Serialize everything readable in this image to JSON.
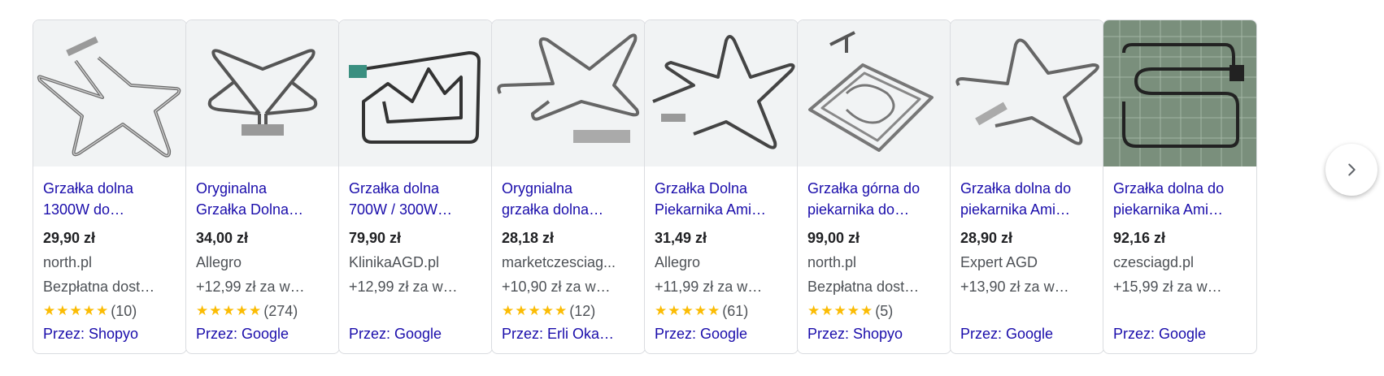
{
  "products": [
    {
      "title_line1": "Grzałka dolna",
      "title_line2": "1300W do…",
      "price": "29,90 zł",
      "store": "north.pl",
      "shipping": "Bezpłatna dost…",
      "stars": "★★★★★",
      "rating_count": "(10)",
      "via": "Przez: Shopyo",
      "image": "heating-element-star-icon"
    },
    {
      "title_line1": "Oryginalna",
      "title_line2": "Grzałka Dolna…",
      "price": "34,00 zł",
      "store": "Allegro",
      "shipping": "+12,99 zł za w…",
      "stars": "★★★★★",
      "rating_count": "(274)",
      "via": "Przez: Google",
      "image": "heating-element-butterfly-icon"
    },
    {
      "title_line1": "Grzałka dolna",
      "title_line2": "700W / 300W…",
      "price": "79,90 zł",
      "store": "KlinikaAGD.pl",
      "shipping": "+12,99 zł za w…",
      "stars": "",
      "rating_count": "",
      "via": "Przez: Google",
      "image": "heating-element-square-icon"
    },
    {
      "title_line1": "Orygnialna",
      "title_line2": "grzałka dolna…",
      "price": "28,18 zł",
      "store": "marketczesciag...",
      "shipping": "+10,90 zł za w…",
      "stars": "★★★★★",
      "rating_count": "(12)",
      "via": "Przez: Erli Oka…",
      "image": "heating-element-star-icon"
    },
    {
      "title_line1": "Grzałka Dolna",
      "title_line2": "Piekarnika Ami…",
      "price": "31,49 zł",
      "store": "Allegro",
      "shipping": "+11,99 zł za w…",
      "stars": "★★★★★",
      "rating_count": "(61)",
      "via": "Przez: Google",
      "image": "heating-element-star-icon"
    },
    {
      "title_line1": "Grzałka górna do",
      "title_line2": "piekarnika do…",
      "price": "99,00 zł",
      "store": "north.pl",
      "shipping": "Bezpłatna dost…",
      "stars": "★★★★★",
      "rating_count": "(5)",
      "via": "Przez: Shopyo",
      "image": "heating-element-double-loop-icon"
    },
    {
      "title_line1": "Grzałka dolna do",
      "title_line2": "piekarnika Ami…",
      "price": "28,90 zł",
      "store": "Expert AGD",
      "shipping": "+13,90 zł za w…",
      "stars": "",
      "rating_count": "",
      "via": "Przez: Google",
      "image": "heating-element-star-icon"
    },
    {
      "title_line1": "Grzałka dolna do",
      "title_line2": "piekarnika Ami…",
      "price": "92,16 zł",
      "store": "czesciagd.pl",
      "shipping": "+15,99 zł za w…",
      "stars": "",
      "rating_count": "",
      "via": "Przez: Google",
      "image": "heating-element-on-grid-icon"
    }
  ],
  "next_button": {
    "icon": "chevron-right-icon"
  },
  "colors": {
    "link": "#1a0dab",
    "star": "#fbbc04",
    "border": "#dadce0",
    "text": "#202124",
    "muted": "#4d5156"
  }
}
